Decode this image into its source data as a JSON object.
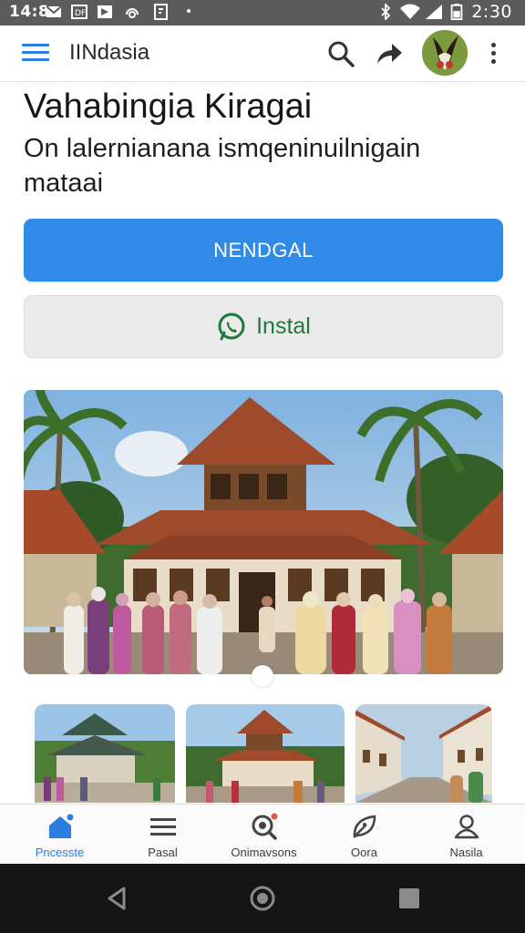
{
  "status_bar": {
    "left_time": "14:8",
    "time": "2:30",
    "icons": [
      "mail-icon",
      "image-icon",
      "play-icon",
      "headset-icon",
      "file-icon",
      "dot-icon",
      "bluetooth-icon",
      "wifi-icon",
      "signal-icon",
      "battery-icon"
    ]
  },
  "app_bar": {
    "title": "IINdasia",
    "icons": [
      "menu-icon",
      "search-icon",
      "share-icon",
      "avatar",
      "more-vert-icon"
    ]
  },
  "content": {
    "headline": "Vahabingia Kiragai",
    "subtitle": "On lalernianana ismqeninuilnigain mataai",
    "primary_button": "NENDGAL",
    "secondary_button": "Instal",
    "secondary_icon": "whatsapp-icon"
  },
  "bottom_nav": [
    {
      "label": "Pncesste",
      "icon": "home-icon",
      "active": true
    },
    {
      "label": "Pasal",
      "icon": "list-icon",
      "active": false
    },
    {
      "label": "Onimavsons",
      "icon": "search-icon",
      "active": false
    },
    {
      "label": "Oora",
      "icon": "leaf-icon",
      "active": false
    },
    {
      "label": "Nasila",
      "icon": "person-icon",
      "active": false
    }
  ],
  "colors": {
    "accent": "#2f8ae8",
    "status_bar": "#5c5c5c",
    "secondary_text": "#1e7a3c",
    "system_nav": "#151515"
  }
}
